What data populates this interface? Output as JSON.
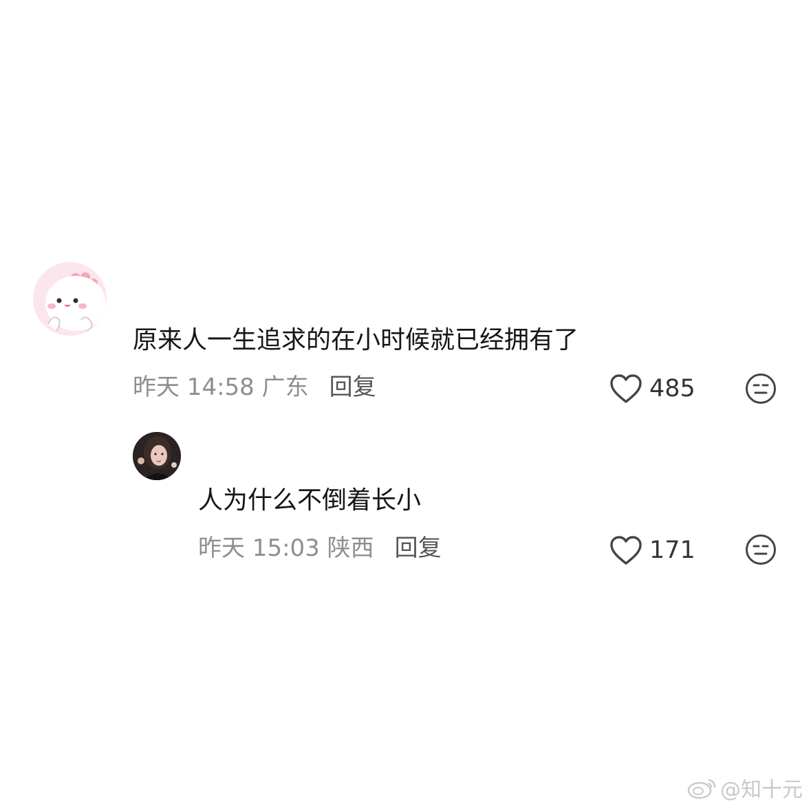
{
  "comments": [
    {
      "text": "原来人一生追求的在小时候就已经拥有了",
      "time_location": "昨天 14:58 广东",
      "reply_label": "回复",
      "likes": "485",
      "avatar_icon": "pink-dinosaur-avatar",
      "avatar_color": "#fbe6ec"
    },
    {
      "text": "人为什么不倒着长小",
      "time_location": "昨天 15:03 陕西",
      "reply_label": "回复",
      "likes": "171",
      "avatar_icon": "person-photo-avatar",
      "avatar_color": "#2a2322"
    }
  ],
  "icons": {
    "like": "heart-outline-icon",
    "react": "neutral-face-icon"
  },
  "watermark": {
    "text": "@知十元",
    "icon": "weibo-logo-icon"
  },
  "colors": {
    "text_primary": "#161616",
    "text_secondary": "#8e8e8e",
    "reply": "#555555",
    "icon_stroke": "#444444"
  }
}
